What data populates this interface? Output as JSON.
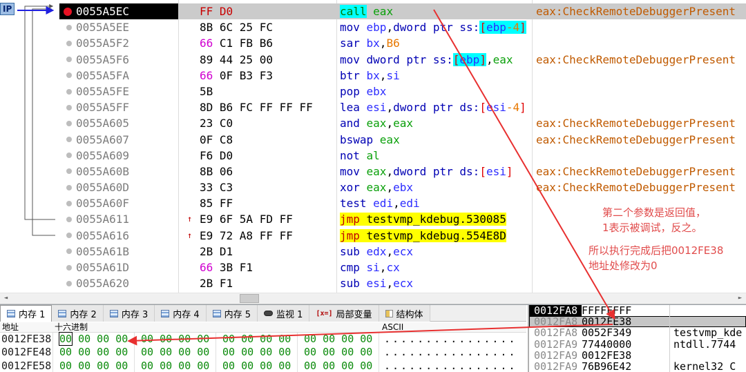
{
  "window": {
    "eip_badge": "IP"
  },
  "colors": {
    "highlight_yellow": "#FFFF00",
    "highlight_cyan": "#00FFFF",
    "comment_orange": "#C05A00",
    "annotation_red": "#E83030",
    "dump_byte_green": "#0A8A0A",
    "breakpoint_red": "#E81123"
  },
  "disasm": {
    "rows": [
      {
        "addr": "0055A5EC",
        "bp": true,
        "sel": true,
        "bytes": [
          [
            "FF D0",
            "bred"
          ]
        ],
        "instr": [
          [
            "call",
            "call"
          ],
          [
            " ",
            "k"
          ],
          [
            "eax",
            "g"
          ]
        ],
        "comment": "eax:CheckRemoteDebuggerPresent"
      },
      {
        "addr": "0055A5EE",
        "bytes": [
          [
            "8B 6C 25 FC",
            "k"
          ]
        ],
        "instr": [
          [
            "mov ",
            "m"
          ],
          [
            "ebp",
            "r"
          ],
          [
            ",",
            "k"
          ],
          [
            "dword ptr ",
            "m"
          ],
          [
            "ss:",
            "m"
          ],
          [
            "[",
            "b hl"
          ],
          [
            "ebp",
            "r hl"
          ],
          [
            "-4",
            "n hl"
          ],
          [
            "]",
            "b hl"
          ]
        ],
        "comment": ""
      },
      {
        "addr": "0055A5F2",
        "bytes": [
          [
            "66",
            "bmag"
          ],
          [
            " C1 FB B6",
            "k"
          ]
        ],
        "instr": [
          [
            "sar ",
            "m"
          ],
          [
            "bx",
            "r"
          ],
          [
            ",",
            "k"
          ],
          [
            "B6",
            "n"
          ]
        ],
        "comment": ""
      },
      {
        "addr": "0055A5F6",
        "bytes": [
          [
            "89 44 25 00",
            "k"
          ]
        ],
        "instr": [
          [
            "mov ",
            "m"
          ],
          [
            "dword ptr ",
            "m"
          ],
          [
            "ss:",
            "m"
          ],
          [
            "[",
            "b hl"
          ],
          [
            "ebp",
            "r hl"
          ],
          [
            "]",
            "b hl"
          ],
          [
            ",",
            "k"
          ],
          [
            "eax",
            "g"
          ]
        ],
        "comment": "eax:CheckRemoteDebuggerPresent"
      },
      {
        "addr": "0055A5FA",
        "bytes": [
          [
            "66",
            "bmag"
          ],
          [
            " 0F B3 F3",
            "k"
          ]
        ],
        "instr": [
          [
            "btr ",
            "m"
          ],
          [
            "bx",
            "r"
          ],
          [
            ",",
            "k"
          ],
          [
            "si",
            "r"
          ]
        ],
        "comment": ""
      },
      {
        "addr": "0055A5FE",
        "bytes": [
          [
            "5B",
            "k"
          ]
        ],
        "instr": [
          [
            "pop ",
            "m"
          ],
          [
            "ebx",
            "r"
          ]
        ],
        "comment": ""
      },
      {
        "addr": "0055A5FF",
        "bytes": [
          [
            "8D B6 FC FF FF FF",
            "k"
          ]
        ],
        "instr": [
          [
            "lea ",
            "m"
          ],
          [
            "esi",
            "r"
          ],
          [
            ",",
            "k"
          ],
          [
            "dword ptr ",
            "m"
          ],
          [
            "ds:",
            "m"
          ],
          [
            "[",
            "b"
          ],
          [
            "esi",
            "r"
          ],
          [
            "-4",
            "n"
          ],
          [
            "]",
            "b"
          ]
        ],
        "comment": ""
      },
      {
        "addr": "0055A605",
        "bytes": [
          [
            "23 C0",
            "k"
          ]
        ],
        "instr": [
          [
            "and ",
            "m"
          ],
          [
            "eax",
            "g"
          ],
          [
            ",",
            "k"
          ],
          [
            "eax",
            "g"
          ]
        ],
        "comment": "eax:CheckRemoteDebuggerPresent"
      },
      {
        "addr": "0055A607",
        "bytes": [
          [
            "0F C8",
            "k"
          ]
        ],
        "instr": [
          [
            "bswap ",
            "m"
          ],
          [
            "eax",
            "g"
          ]
        ],
        "comment": "eax:CheckRemoteDebuggerPresent"
      },
      {
        "addr": "0055A609",
        "bytes": [
          [
            "F6 D0",
            "k"
          ]
        ],
        "instr": [
          [
            "not ",
            "m"
          ],
          [
            "al",
            "g"
          ]
        ],
        "comment": ""
      },
      {
        "addr": "0055A60B",
        "bytes": [
          [
            "8B 06",
            "k"
          ]
        ],
        "instr": [
          [
            "mov ",
            "m"
          ],
          [
            "eax",
            "g"
          ],
          [
            ",",
            "k"
          ],
          [
            "dword ptr ",
            "m"
          ],
          [
            "ds:",
            "m"
          ],
          [
            "[",
            "b"
          ],
          [
            "esi",
            "r"
          ],
          [
            "]",
            "b"
          ]
        ],
        "comment": "eax:CheckRemoteDebuggerPresent"
      },
      {
        "addr": "0055A60D",
        "bytes": [
          [
            "33 C3",
            "k"
          ]
        ],
        "instr": [
          [
            "xor ",
            "m"
          ],
          [
            "eax",
            "g"
          ],
          [
            ",",
            "k"
          ],
          [
            "ebx",
            "r"
          ]
        ],
        "comment": "eax:CheckRemoteDebuggerPresent"
      },
      {
        "addr": "0055A60F",
        "bytes": [
          [
            "85 FF",
            "k"
          ]
        ],
        "instr": [
          [
            "test ",
            "m"
          ],
          [
            "edi",
            "r"
          ],
          [
            ",",
            "k"
          ],
          [
            "edi",
            "r"
          ]
        ],
        "comment": ""
      },
      {
        "addr": "0055A611",
        "up": true,
        "bytes": [
          [
            "E9 6F 5A FD FF",
            "k"
          ]
        ],
        "instr": [
          [
            "jmp ",
            "jr"
          ],
          [
            "testvmp_kdebug.530085",
            "jk"
          ]
        ],
        "comment": ""
      },
      {
        "addr": "0055A616",
        "up": true,
        "bytes": [
          [
            "E9 72 A8 FF FF",
            "k"
          ]
        ],
        "instr": [
          [
            "jmp ",
            "jr"
          ],
          [
            "testvmp_kdebug.554E8D",
            "jk"
          ]
        ],
        "comment": ""
      },
      {
        "addr": "0055A61B",
        "bytes": [
          [
            "2B D1",
            "k"
          ]
        ],
        "instr": [
          [
            "sub ",
            "m"
          ],
          [
            "edx",
            "r"
          ],
          [
            ",",
            "k"
          ],
          [
            "ecx",
            "r"
          ]
        ],
        "comment": ""
      },
      {
        "addr": "0055A61D",
        "bytes": [
          [
            "66",
            "bmag"
          ],
          [
            " 3B F1",
            "k"
          ]
        ],
        "instr": [
          [
            "cmp ",
            "m"
          ],
          [
            "si",
            "r"
          ],
          [
            ",",
            "k"
          ],
          [
            "cx",
            "r"
          ]
        ],
        "comment": ""
      },
      {
        "addr": "0055A620",
        "bytes": [
          [
            "2B F1",
            "k"
          ]
        ],
        "instr": [
          [
            "sub ",
            "m"
          ],
          [
            "esi",
            "r"
          ],
          [
            ",",
            "k"
          ],
          [
            "ecx",
            "r"
          ]
        ],
        "comment": ""
      }
    ]
  },
  "tabs": [
    {
      "name": "tab-memory-1",
      "label": "内存 1",
      "icon": "memory-icon",
      "active": true
    },
    {
      "name": "tab-memory-2",
      "label": "内存 2",
      "icon": "memory-icon"
    },
    {
      "name": "tab-memory-3",
      "label": "内存 3",
      "icon": "memory-icon"
    },
    {
      "name": "tab-memory-4",
      "label": "内存 4",
      "icon": "memory-icon"
    },
    {
      "name": "tab-memory-5",
      "label": "内存 5",
      "icon": "memory-icon"
    },
    {
      "name": "tab-watch-1",
      "label": "监视 1",
      "icon": "watch-icon"
    },
    {
      "name": "tab-locals",
      "label": "局部变量",
      "icon": "locals-icon",
      "icon_text": "[x=]"
    },
    {
      "name": "tab-struct",
      "label": "结构体",
      "icon": "struct-icon"
    }
  ],
  "dump": {
    "headers": {
      "addr": "地址",
      "hex": "十六进制",
      "ascii": "ASCII"
    },
    "rows": [
      {
        "addr": "0012FE38",
        "sel_first": true,
        "groups": [
          "00 00 00 00",
          "00 00 00 00",
          "00 00 00 00",
          "00 00 00 00"
        ],
        "ascii": "................"
      },
      {
        "addr": "0012FE48",
        "groups": [
          "00 00 00 00",
          "00 00 00 00",
          "00 00 00 00",
          "00 00 00 00"
        ],
        "ascii": "................"
      },
      {
        "addr": "0012FE58",
        "groups": [
          "00 00 00 00",
          "00 00 00 00",
          "00 00 00 00",
          "00 00 00 00"
        ],
        "ascii": "................"
      }
    ]
  },
  "stack": {
    "rows": [
      {
        "addr": "0012FA8",
        "value": "FFFFFFFF",
        "comment": "",
        "esp": true
      },
      {
        "addr": "0012FA8",
        "value": "0012FE38",
        "comment": "",
        "sel": true
      },
      {
        "addr": "0012FA8",
        "value": "0052F349",
        "comment": "testvmp_kde"
      },
      {
        "addr": "0012FA9",
        "value": "77440000",
        "comment": "ntdll.7744"
      },
      {
        "addr": "0012FA9",
        "value": "0012FE38",
        "comment": ""
      },
      {
        "addr": "0012FA9",
        "value": "76B96E42",
        "comment": "kernel32_C"
      }
    ]
  },
  "notes": [
    {
      "lines": [
        "第二个参数是返回值，",
        "1表示被调试，反之。"
      ]
    },
    {
      "lines": [
        "所以执行完成后把0012FE38",
        "地址处修改为0"
      ]
    }
  ]
}
